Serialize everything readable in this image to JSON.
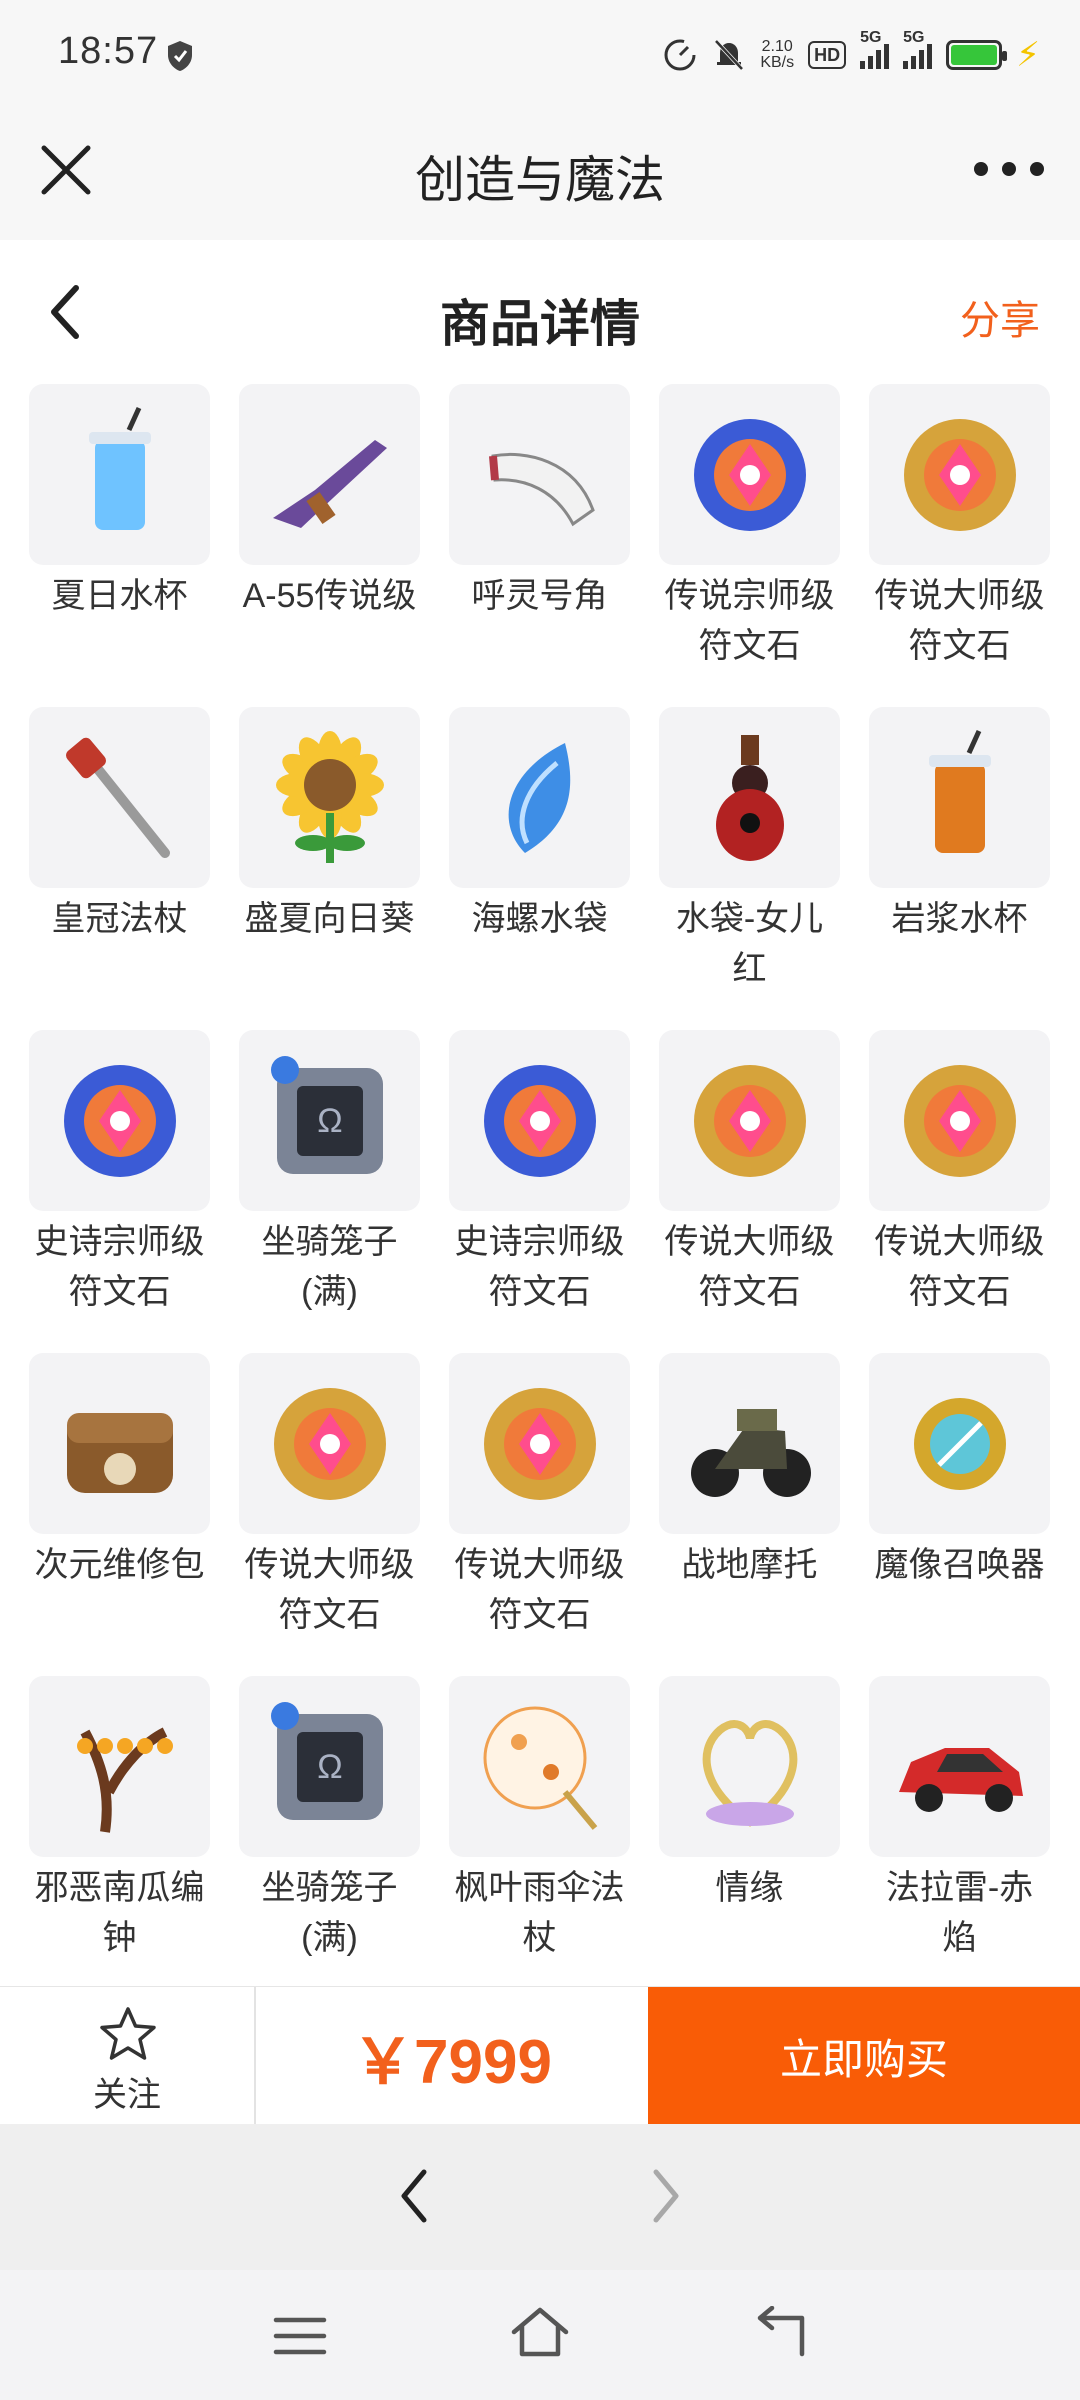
{
  "status_bar": {
    "time": "18:57",
    "net_speed_value": "2.10",
    "net_speed_unit": "KB/s",
    "hd_label": "HD",
    "sim1_label": "5G",
    "sim2_label": "5G"
  },
  "app_bar": {
    "title": "创造与魔法"
  },
  "header": {
    "title": "商品详情",
    "share_label": "分享"
  },
  "items": [
    {
      "label": "夏日水杯",
      "icon": "cup-icon",
      "color": "#6fc3ff"
    },
    {
      "label": "A-55传说级",
      "icon": "rifle-icon",
      "color": "#6a4a9a"
    },
    {
      "label": "呼灵号角",
      "icon": "horn-icon",
      "color": "#b23a48"
    },
    {
      "label": "传说宗师级符文石",
      "icon": "rune-stone-icon",
      "color": "#3b5bd6"
    },
    {
      "label": "传说大师级符文石",
      "icon": "rune-stone-icon",
      "color": "#d6a33b"
    },
    {
      "label": "皇冠法杖",
      "icon": "staff-icon",
      "color": "#c0392b"
    },
    {
      "label": "盛夏向日葵",
      "icon": "sunflower-icon",
      "color": "#f7c531"
    },
    {
      "label": "海螺水袋",
      "icon": "conch-icon",
      "color": "#3e8ee6"
    },
    {
      "label": "水袋-女儿红",
      "icon": "gourd-icon",
      "color": "#b22222"
    },
    {
      "label": "岩浆水杯",
      "icon": "cup-icon",
      "color": "#e07a1f"
    },
    {
      "label": "史诗宗师级符文石",
      "icon": "rune-stone-icon",
      "color": "#3b5bd6"
    },
    {
      "label": "坐骑笼子(满)",
      "icon": "cage-icon",
      "color": "#7b8496"
    },
    {
      "label": "史诗宗师级符文石",
      "icon": "rune-stone-icon",
      "color": "#3b5bd6"
    },
    {
      "label": "传说大师级符文石",
      "icon": "rune-stone-icon",
      "color": "#d6a33b"
    },
    {
      "label": "传说大师级符文石",
      "icon": "rune-stone-icon",
      "color": "#d6a33b"
    },
    {
      "label": "次元维修包",
      "icon": "repair-bag-icon",
      "color": "#8a5a2b"
    },
    {
      "label": "传说大师级符文石",
      "icon": "rune-stone-icon",
      "color": "#d6a33b"
    },
    {
      "label": "传说大师级符文石",
      "icon": "rune-stone-icon",
      "color": "#d6a33b"
    },
    {
      "label": "战地摩托",
      "icon": "motorcycle-icon",
      "color": "#4b4b3b"
    },
    {
      "label": "魔像召唤器",
      "icon": "summoner-icon",
      "color": "#d4a72c"
    },
    {
      "label": "邪恶南瓜编钟",
      "icon": "pumpkin-tree-icon",
      "color": "#6b3a1e"
    },
    {
      "label": "坐骑笼子(满)",
      "icon": "cage-icon",
      "color": "#7b8496"
    },
    {
      "label": "枫叶雨伞法杖",
      "icon": "umbrella-icon",
      "color": "#f0a050"
    },
    {
      "label": "情缘",
      "icon": "heart-icon",
      "color": "#c9a6e8"
    },
    {
      "label": "法拉雷-赤焰",
      "icon": "car-icon",
      "color": "#d42a2a"
    },
    {
      "label": "",
      "icon": "moon-staff-icon",
      "color": "#e0c35a"
    },
    {
      "label": "",
      "icon": "mask-icon",
      "color": "#c98a2a"
    },
    {
      "label": "",
      "icon": "flamingo-icon",
      "color": "#e86a8a"
    },
    {
      "label": "",
      "icon": "vehicle-icon",
      "color": "#2a3a6a"
    },
    {
      "label": "",
      "icon": "vehicle-icon",
      "color": "#2a3a6a"
    }
  ],
  "bottom_bar": {
    "follow_label": "关注",
    "price": "￥7999",
    "buy_label": "立即购买"
  },
  "colors": {
    "accent": "#f95c06",
    "price": "#f2601c",
    "battery": "#36c63a"
  }
}
